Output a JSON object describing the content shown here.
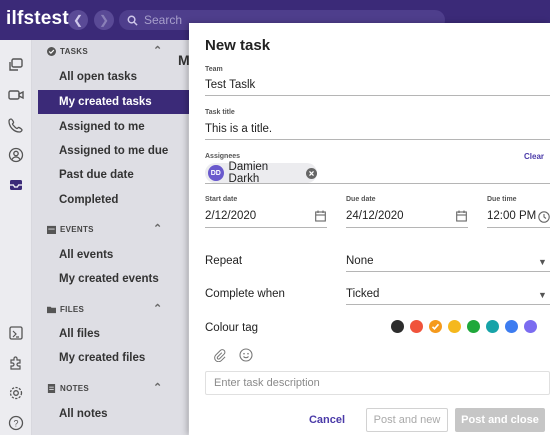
{
  "app": {
    "logo": "ilfstest"
  },
  "topbar": {
    "search_placeholder": "Search"
  },
  "sidebar": {
    "sections": [
      {
        "title": "TASKS",
        "items": [
          "All open tasks",
          "My created tasks",
          "Assigned to me",
          "Assigned to me due",
          "Past due date",
          "Completed"
        ],
        "active": "My created tasks"
      },
      {
        "title": "EVENTS",
        "items": [
          "All events",
          "My created events"
        ]
      },
      {
        "title": "FILES",
        "items": [
          "All files",
          "My created files"
        ]
      },
      {
        "title": "NOTES",
        "items": [
          "All notes"
        ]
      }
    ]
  },
  "background": {
    "hint": "M"
  },
  "dialog": {
    "title": "New task",
    "team": {
      "label": "Team",
      "value": "Test Taslk"
    },
    "task_title": {
      "label": "Task title",
      "value": "This is a title."
    },
    "assignees": {
      "label": "Assignees",
      "clear_label": "Clear",
      "chips": [
        {
          "initials": "DD",
          "name": "Damien Darkh"
        }
      ]
    },
    "start_date": {
      "label": "Start date",
      "value": "2/12/2020"
    },
    "due_date": {
      "label": "Due date",
      "value": "24/12/2020"
    },
    "due_time": {
      "label": "Due time",
      "value": "12:00 PM"
    },
    "repeat": {
      "label": "Repeat",
      "value": "None"
    },
    "complete_when": {
      "label": "Complete when",
      "value": "Ticked"
    },
    "colour_tag": {
      "label": "Colour tag",
      "colors": [
        "#2d2d2d",
        "#f0533b",
        "#f59a1d",
        "#f5b81d",
        "#1fa83a",
        "#17a3a8",
        "#3d7cf0",
        "#7b6cf0"
      ],
      "selected_index": 2
    },
    "description": {
      "placeholder": "Enter task description"
    },
    "buttons": {
      "cancel": "Cancel",
      "post_and_new": "Post and new",
      "post_and_close": "Post and close"
    }
  },
  "colors": {
    "brand": "#3b2a78",
    "accent": "#4a3aa8",
    "link": "#4a3aa8",
    "avatar": "#6a5acd"
  }
}
